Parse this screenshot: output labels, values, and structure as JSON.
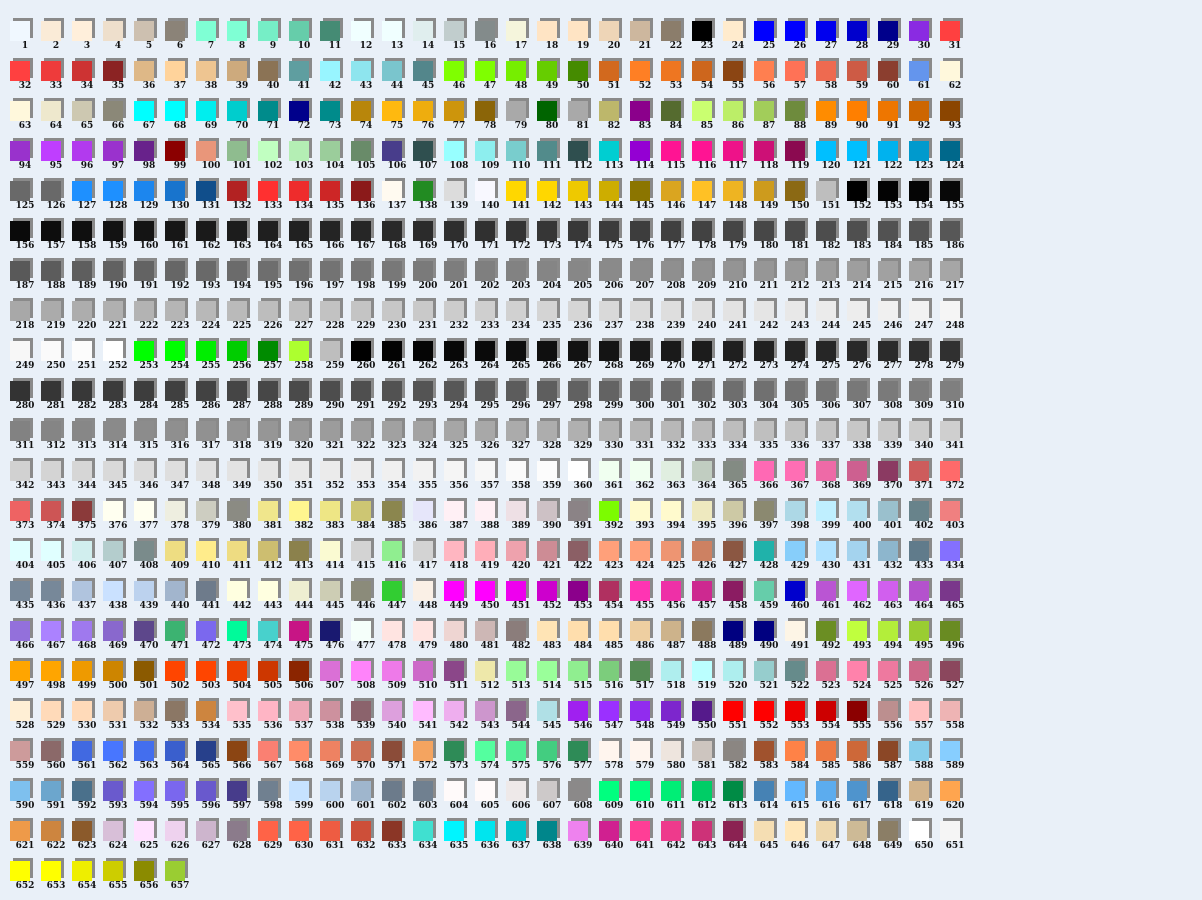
{
  "palette": {
    "colors": [
      "#f0f8ff",
      "#faebd7",
      "#ffefdb",
      "#eedfcc",
      "#cdc0b0",
      "#8b8378",
      "#7fffd4",
      "#7fffd4",
      "#76eec6",
      "#66cdaa",
      "#458b74",
      "#f0ffff",
      "#f0ffff",
      "#e0eeee",
      "#c1cdcd",
      "#838b8b",
      "#f5f5dc",
      "#ffe4c4",
      "#ffe4c4",
      "#eed5b7",
      "#cdb79e",
      "#8b7d6b",
      "#000000",
      "#ffebcd",
      "#0000ff",
      "#0000ff",
      "#0000ee",
      "#0000cd",
      "#00008b",
      "#8a2be2",
      "#ff4040",
      "#ff4040",
      "#ee3b3b",
      "#cd3333",
      "#8b2323",
      "#deb887",
      "#ffd39b",
      "#eec591",
      "#cdaa7d",
      "#8b7355",
      "#5f9ea0",
      "#98f5ff",
      "#8ee5ee",
      "#7ac5cd",
      "#53868b",
      "#7fff00",
      "#7fff00",
      "#76ee00",
      "#66cd00",
      "#458b00",
      "#d2691e",
      "#ff7f24",
      "#ee7621",
      "#cd661d",
      "#8b4513",
      "#ff7f50",
      "#ff7256",
      "#ee6a50",
      "#cd5b45",
      "#8b3e2f",
      "#6495ed",
      "#fff8dc",
      "#fff8dc",
      "#eee8cd",
      "#cdc8b1",
      "#8b8878",
      "#00ffff",
      "#00ffff",
      "#00eeee",
      "#00cdcd",
      "#008b8b",
      "#00008b",
      "#008b8b",
      "#b8860b",
      "#ffb90f",
      "#eead0e",
      "#cd950c",
      "#8b6508",
      "#a9a9a9",
      "#006400",
      "#a9a9a9",
      "#bdb76b",
      "#8b008b",
      "#556b2f",
      "#caff70",
      "#bcee68",
      "#a2cd5a",
      "#6e8b3d",
      "#ff8c00",
      "#ff7f00",
      "#ee7600",
      "#cd6600",
      "#8b4500",
      "#9932cc",
      "#bf3eff",
      "#b23aee",
      "#9a32cd",
      "#68228b",
      "#8b0000",
      "#e9967a",
      "#8fbc8f",
      "#c1ffc1",
      "#b4eeb4",
      "#9bcd9b",
      "#698b69",
      "#483d8b",
      "#2f4f4f",
      "#97ffff",
      "#8deeee",
      "#79cdcd",
      "#528b8b",
      "#2f4f4f",
      "#00ced1",
      "#9400d3",
      "#ff1493",
      "#ff1493",
      "#ee1289",
      "#cd1076",
      "#8b0a50",
      "#00bfff",
      "#00bfff",
      "#00b2ee",
      "#009acd",
      "#00688b",
      "#696969",
      "#696969",
      "#1e90ff",
      "#1e90ff",
      "#1c86ee",
      "#1874cd",
      "#104e8b",
      "#b22222",
      "#ff3030",
      "#ee2c2c",
      "#cd2626",
      "#8b1a1a",
      "#fffaf0",
      "#228b22",
      "#dcdcdc",
      "#f8f8ff",
      "#ffd700",
      "#ffd700",
      "#eec900",
      "#cdad00",
      "#8b7500",
      "#daa520",
      "#ffc125",
      "#eeb422",
      "#cd9b1d",
      "#8b6914",
      "#bebebe",
      "#000000",
      "#030303",
      "#050505",
      "#080808",
      "#0a0a0a",
      "#0d0d0d",
      "#0f0f0f",
      "#121212",
      "#141414",
      "#171717",
      "#1a1a1a",
      "#1c1c1c",
      "#1f1f1f",
      "#212121",
      "#242424",
      "#262626",
      "#292929",
      "#2b2b2b",
      "#2e2e2e",
      "#303030",
      "#333333",
      "#363636",
      "#383838",
      "#3b3b3b",
      "#3d3d3d",
      "#404040",
      "#424242",
      "#454545",
      "#474747",
      "#4a4a4a",
      "#4d4d4d",
      "#4f4f4f",
      "#525252",
      "#545454",
      "#575757",
      "#595959",
      "#5c5c5c",
      "#5e5e5e",
      "#616161",
      "#636363",
      "#666666",
      "#696969",
      "#6b6b6b",
      "#6e6e6e",
      "#707070",
      "#737373",
      "#757575",
      "#787878",
      "#7a7a7a",
      "#7d7d7d",
      "#7f7f7f",
      "#828282",
      "#858585",
      "#878787",
      "#8a8a8a",
      "#8c8c8c",
      "#8f8f8f",
      "#919191",
      "#949494",
      "#969696",
      "#999999",
      "#9c9c9c",
      "#9e9e9e",
      "#a1a1a1",
      "#a3a3a3",
      "#a6a6a6",
      "#a8a8a8",
      "#ababab",
      "#adadad",
      "#b0b0b0",
      "#b3b3b3",
      "#b5b5b5",
      "#b8b8b8",
      "#bababa",
      "#bdbdbd",
      "#bfbfbf",
      "#c2c2c2",
      "#c4c4c4",
      "#c7c7c7",
      "#c9c9c9",
      "#cccccc",
      "#cfcfcf",
      "#d1d1d1",
      "#d4d4d4",
      "#d6d6d6",
      "#d9d9d9",
      "#dbdbdb",
      "#dedede",
      "#e0e0e0",
      "#e3e3e3",
      "#e5e5e5",
      "#e8e8e8",
      "#ebebeb",
      "#ededed",
      "#f0f0f0",
      "#f2f2f2",
      "#f5f5f5",
      "#f7f7f7",
      "#fafafa",
      "#fcfcfc",
      "#ffffff",
      "#00ff00",
      "#00ff00",
      "#00ee00",
      "#00cd00",
      "#008b00",
      "#adff2f",
      "#bebebe",
      "#000000",
      "#030303",
      "#050505",
      "#080808",
      "#0a0a0a",
      "#0d0d0d",
      "#0f0f0f",
      "#121212",
      "#141414",
      "#171717",
      "#1a1a1a",
      "#1c1c1c",
      "#1f1f1f",
      "#212121",
      "#242424",
      "#262626",
      "#292929",
      "#2b2b2b",
      "#2e2e2e",
      "#303030",
      "#333333",
      "#363636",
      "#383838",
      "#3b3b3b",
      "#3d3d3d",
      "#404040",
      "#424242",
      "#454545",
      "#474747",
      "#4a4a4a",
      "#4d4d4d",
      "#4f4f4f",
      "#525252",
      "#545454",
      "#575757",
      "#595959",
      "#5c5c5c",
      "#5e5e5e",
      "#616161",
      "#636363",
      "#666666",
      "#696969",
      "#6b6b6b",
      "#6e6e6e",
      "#707070",
      "#737373",
      "#757575",
      "#787878",
      "#7a7a7a",
      "#7d7d7d",
      "#7f7f7f",
      "#828282",
      "#858585",
      "#878787",
      "#8a8a8a",
      "#8c8c8c",
      "#8f8f8f",
      "#919191",
      "#949494",
      "#969696",
      "#999999",
      "#9c9c9c",
      "#9e9e9e",
      "#a1a1a1",
      "#a3a3a3",
      "#a6a6a6",
      "#a8a8a8",
      "#ababab",
      "#adadad",
      "#b0b0b0",
      "#b3b3b3",
      "#b5b5b5",
      "#b8b8b8",
      "#bababa",
      "#bdbdbd",
      "#bfbfbf",
      "#c2c2c2",
      "#c4c4c4",
      "#c7c7c7",
      "#c9c9c9",
      "#cccccc",
      "#cfcfcf",
      "#d1d1d1",
      "#d4d4d4",
      "#d6d6d6",
      "#d9d9d9",
      "#dbdbdb",
      "#dedede",
      "#e0e0e0",
      "#e3e3e3",
      "#e5e5e5",
      "#e8e8e8",
      "#ebebeb",
      "#ededed",
      "#f0f0f0",
      "#f2f2f2",
      "#f5f5f5",
      "#f7f7f7",
      "#fafafa",
      "#fcfcfc",
      "#ffffff",
      "#f0fff0",
      "#f0fff0",
      "#e0eee0",
      "#c1cdc1",
      "#838b83",
      "#ff69b4",
      "#ff6eb4",
      "#ee6aa7",
      "#cd6090",
      "#8b3a62",
      "#cd5c5c",
      "#ff6a6a",
      "#ee6363",
      "#cd5555",
      "#8b3a3a",
      "#fffff0",
      "#fffff0",
      "#eeeee0",
      "#cdcdc1",
      "#8b8b83",
      "#f0e68c",
      "#fff68f",
      "#eee685",
      "#cdc673",
      "#8b864e",
      "#e6e6fa",
      "#fff0f5",
      "#fff0f5",
      "#eee0e5",
      "#cdc1c5",
      "#8b8386",
      "#7cfc00",
      "#fffacd",
      "#fffacd",
      "#eee9bf",
      "#cdc9a5",
      "#8b8970",
      "#add8e6",
      "#bfefff",
      "#b2dfee",
      "#9ac0cd",
      "#68838b",
      "#f08080",
      "#e0ffff",
      "#e0ffff",
      "#d1eeee",
      "#b4cdcd",
      "#7a8b8b",
      "#eedd82",
      "#ffec8b",
      "#eedc82",
      "#cdbe70",
      "#8b814c",
      "#fafad2",
      "#d3d3d3",
      "#90ee90",
      "#d3d3d3",
      "#ffb6c1",
      "#ffaeb9",
      "#eea2ad",
      "#cd8c95",
      "#8b5f65",
      "#ffa07a",
      "#ffa07a",
      "#ee9572",
      "#cd8162",
      "#8b5742",
      "#20b2aa",
      "#87cefa",
      "#b0e2ff",
      "#a4d3ee",
      "#8db6cd",
      "#607b8b",
      "#8470ff",
      "#778899",
      "#778899",
      "#b0c4de",
      "#cae1ff",
      "#bcd2ee",
      "#a2b5cd",
      "#6e7b8b",
      "#ffffe0",
      "#ffffe0",
      "#eeeed1",
      "#cdcdb4",
      "#8b8b7a",
      "#32cd32",
      "#faf0e6",
      "#ff00ff",
      "#ff00ff",
      "#ee00ee",
      "#cd00cd",
      "#8b008b",
      "#b03060",
      "#ff34b3",
      "#ee30a7",
      "#cd2990",
      "#8b1c62",
      "#66cdaa",
      "#0000cd",
      "#ba55d3",
      "#e066ff",
      "#d15fee",
      "#b452cd",
      "#7a378b",
      "#9370db",
      "#ab82ff",
      "#9f79ee",
      "#8968cd",
      "#5d478b",
      "#3cb371",
      "#7b68ee",
      "#00fa9a",
      "#48d1cc",
      "#c71585",
      "#191970",
      "#f5fffa",
      "#ffe4e1",
      "#ffe4e1",
      "#eed5d2",
      "#cdb7b5",
      "#8b7d7b",
      "#ffe4b5",
      "#ffdead",
      "#ffdead",
      "#eecfa1",
      "#cdb38b",
      "#8b795e",
      "#000080",
      "#000080",
      "#fdf5e6",
      "#6b8e23",
      "#c0ff3e",
      "#b3ee3a",
      "#9acd32",
      "#698b22",
      "#ffa500",
      "#ffa500",
      "#ee9a00",
      "#cd8500",
      "#8b5a00",
      "#ff4500",
      "#ff4500",
      "#ee4000",
      "#cd3700",
      "#8b2500",
      "#da70d6",
      "#ff83fa",
      "#ee7ae9",
      "#cd69c9",
      "#8b4789",
      "#eee8aa",
      "#98fb98",
      "#9aff9a",
      "#90ee90",
      "#7ccd7c",
      "#548b54",
      "#afeeee",
      "#bbffff",
      "#aeeeee",
      "#96cdcd",
      "#668b8b",
      "#db7093",
      "#ff82ab",
      "#ee799f",
      "#cd6889",
      "#8b475d",
      "#ffefd5",
      "#ffdab9",
      "#ffdab9",
      "#eecbad",
      "#cdaf95",
      "#8b7765",
      "#cd853f",
      "#ffc0cb",
      "#ffb5c5",
      "#eea9b8",
      "#cd919e",
      "#8b636c",
      "#dda0dd",
      "#ffbbff",
      "#eeaeee",
      "#cd96cd",
      "#8b668b",
      "#b0e0e6",
      "#a020f0",
      "#9b30ff",
      "#912cee",
      "#7d26cd",
      "#551a8b",
      "#ff0000",
      "#ff0000",
      "#ee0000",
      "#cd0000",
      "#8b0000",
      "#bc8f8f",
      "#ffc1c1",
      "#eeb4b4",
      "#cd9b9b",
      "#8b6969",
      "#4169e1",
      "#4876ff",
      "#436eee",
      "#3a5fcd",
      "#27408b",
      "#8b4513",
      "#fa8072",
      "#ff8c69",
      "#ee8262",
      "#cd7054",
      "#8b4c39",
      "#f4a460",
      "#2e8b57",
      "#54ff9f",
      "#4eee94",
      "#43cd80",
      "#2e8b57",
      "#fff5ee",
      "#fff5ee",
      "#eee5de",
      "#cdc5bf",
      "#8b8682",
      "#a0522d",
      "#ff8247",
      "#ee7942",
      "#cd6839",
      "#8b4726",
      "#87ceeb",
      "#87ceff",
      "#7ec0ee",
      "#6ca6cd",
      "#4a708b",
      "#6a5acd",
      "#836fff",
      "#7a67ee",
      "#6959cd",
      "#473c8b",
      "#708090",
      "#c6e2ff",
      "#b9d3ee",
      "#9fb6cd",
      "#6c7b8b",
      "#708090",
      "#fffafa",
      "#fffafa",
      "#eee9e9",
      "#cdc9c9",
      "#8b8989",
      "#00ff7f",
      "#00ff7f",
      "#00ee76",
      "#00cd66",
      "#008b45",
      "#4682b4",
      "#63b8ff",
      "#5cacee",
      "#4f94cd",
      "#36648b",
      "#d2b48c",
      "#ffa54f",
      "#ee9a49",
      "#cd853f",
      "#8b5a2b",
      "#d8bfd8",
      "#ffe1ff",
      "#eed2ee",
      "#cdb5cd",
      "#8b7b8b",
      "#ff6347",
      "#ff6347",
      "#ee5c42",
      "#cd4f39",
      "#8b3626",
      "#40e0d0",
      "#00f5ff",
      "#00e5ee",
      "#00c5cd",
      "#00868b",
      "#ee82ee",
      "#d02090",
      "#ff3e96",
      "#ee3a8c",
      "#cd3278",
      "#8b2252",
      "#f5deb3",
      "#ffe7ba",
      "#eed8ae",
      "#cdba96",
      "#8b7e66",
      "#ffffff",
      "#f5f5f5",
      "#ffff00",
      "#ffff00",
      "#eeee00",
      "#cdcd00",
      "#8b8b00",
      "#9acd32"
    ]
  }
}
